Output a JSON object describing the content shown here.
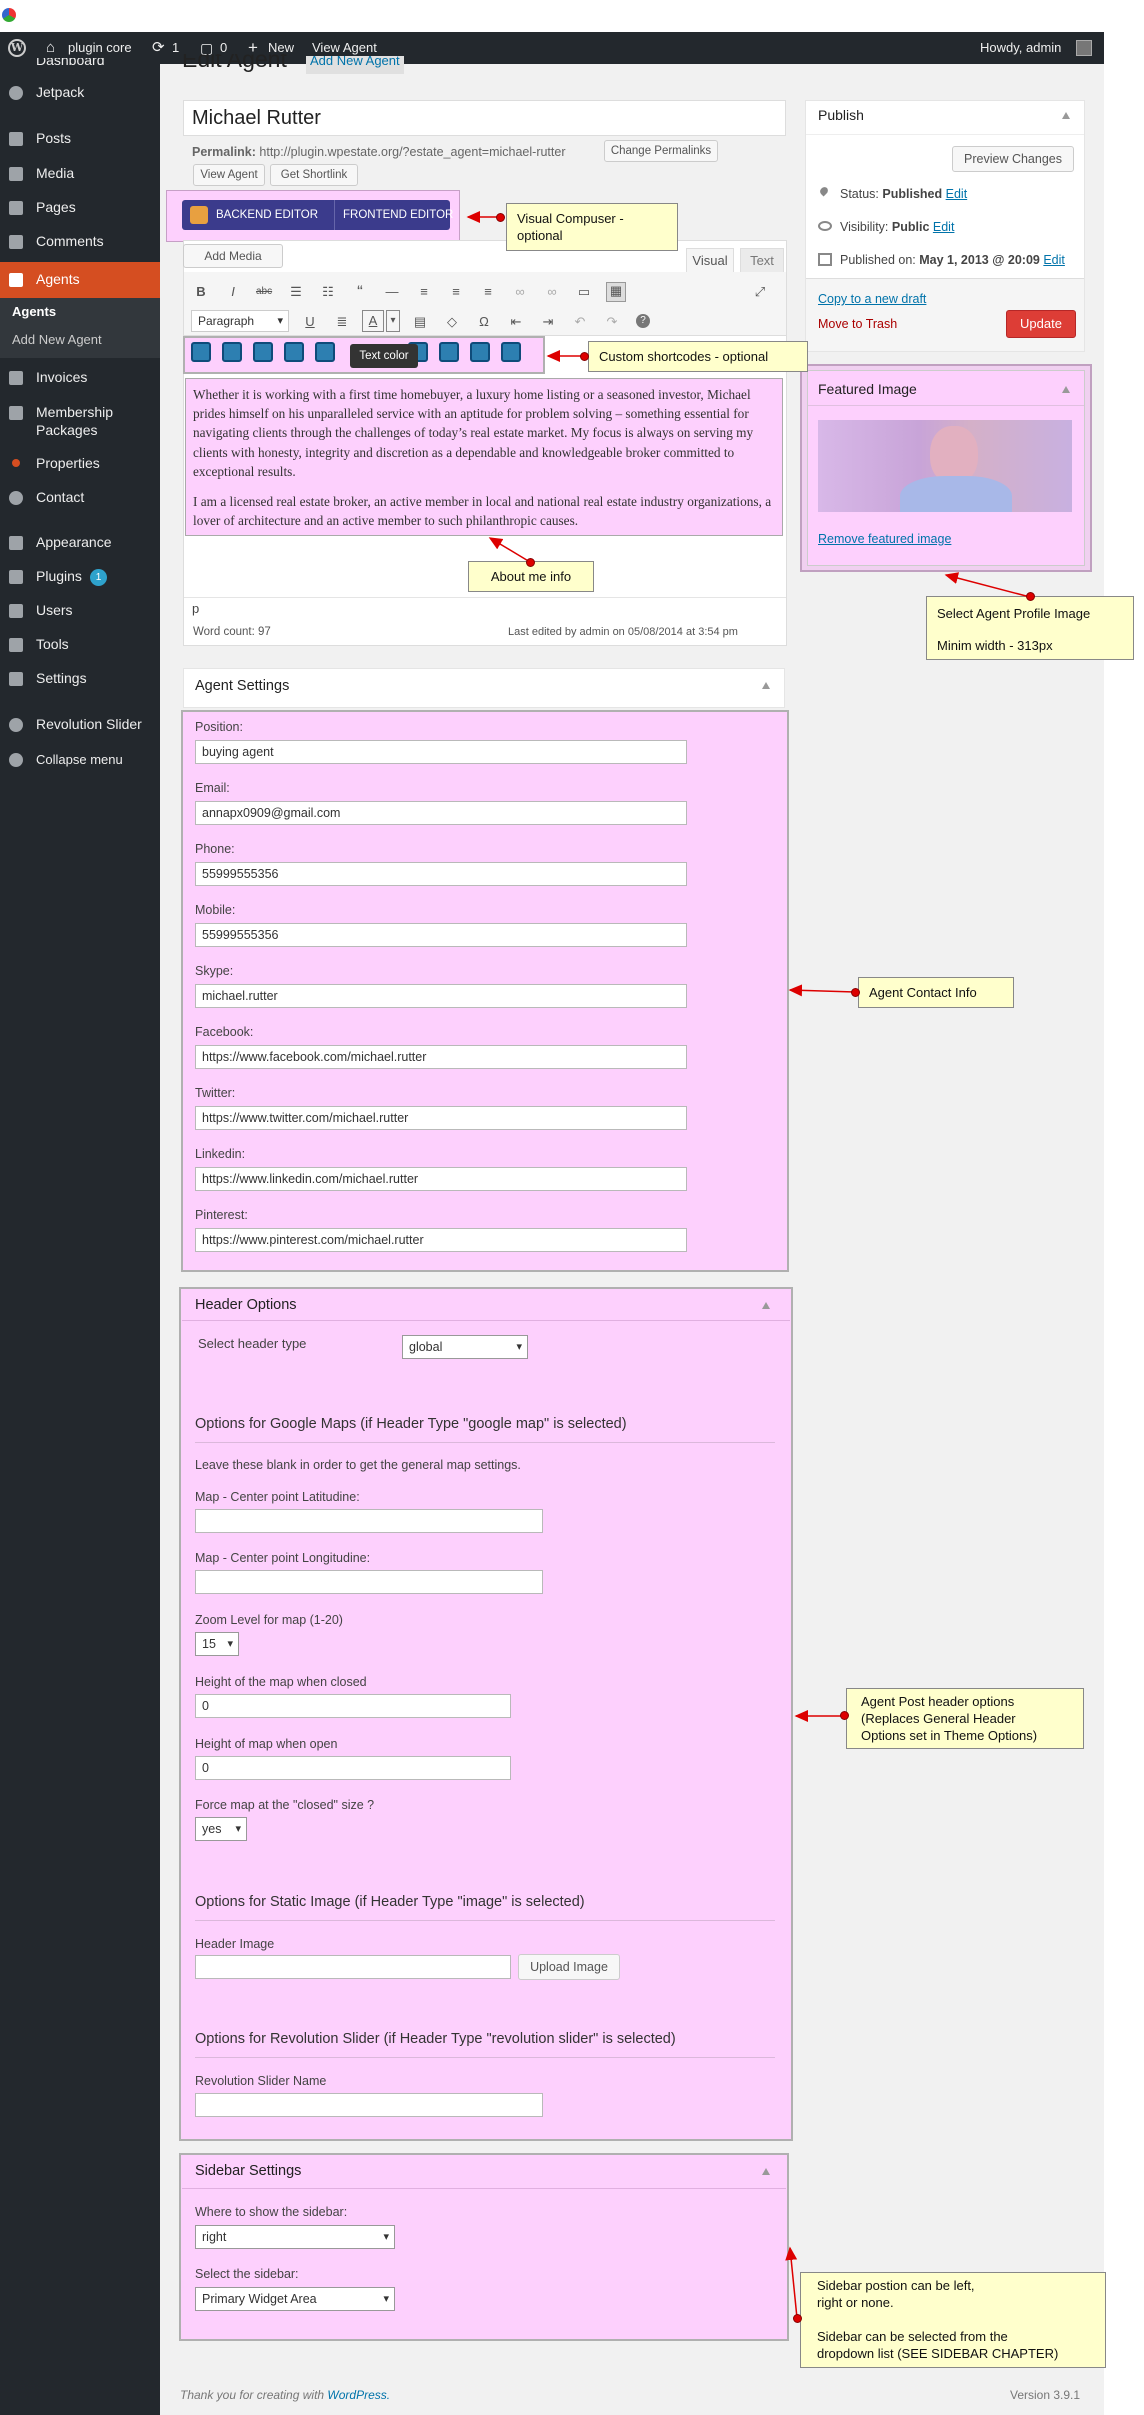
{
  "admin_bar": {
    "site_name": "plugin core",
    "updates": "1",
    "comments": "0",
    "new_label": "New",
    "view_label": "View Agent",
    "howdy": "Howdy, admin"
  },
  "menu": {
    "dashboard": "Dashboard",
    "jetpack": "Jetpack",
    "posts": "Posts",
    "media": "Media",
    "pages": "Pages",
    "comments": "Comments",
    "agents": "Agents",
    "sub_agents": "Agents",
    "sub_add": "Add New Agent",
    "invoices": "Invoices",
    "membership": "Membership",
    "membership2": "Packages",
    "properties": "Properties",
    "contact": "Contact",
    "appearance": "Appearance",
    "plugins": "Plugins",
    "plugins_badge": "1",
    "users": "Users",
    "tools": "Tools",
    "settings": "Settings",
    "revslider": "Revolution Slider",
    "collapse": "Collapse menu"
  },
  "page": {
    "title": "Edit Agent",
    "add_new": "Add New Agent"
  },
  "post": {
    "title": "Michael Rutter",
    "permalink_label": "Permalink:",
    "permalink": "http://plugin.wpestate.org/?estate_agent=michael-rutter",
    "change_permalinks": "Change Permalinks",
    "view_agent": "View Agent",
    "get_shortlink": "Get Shortlink"
  },
  "vc": {
    "backend": "BACKEND EDITOR",
    "frontend": "FRONTEND EDITOR"
  },
  "editor": {
    "add_media": "Add Media",
    "tab_visual": "Visual",
    "tab_text": "Text",
    "paragraph": "Paragraph",
    "tooltip": "Text color",
    "p1": "Whether it is working with a first time homebuyer, a luxury home listing or a seasoned investor, Michael prides himself on his unparalleled service with an aptitude for problem solving – something essential for navigating clients through the challenges of today’s real estate market. My focus is always on serving my clients with honesty, integrity and discretion as a dependable and knowledgeable broker committed to exceptional results.",
    "p2": "I am a licensed real estate broker, an active member in local and national real estate industry organizations, a lover of architecture and an active member to such philanthropic causes.",
    "path": "p",
    "word_count": "Word count: 97",
    "last_edited": "Last edited by admin on 05/08/2014 at 3:54 pm"
  },
  "publish": {
    "title": "Publish",
    "preview": "Preview Changes",
    "status_label": "Status:",
    "status": "Published",
    "visibility_label": "Visibility:",
    "visibility": "Public",
    "published_label": "Published on:",
    "published": "May 1, 2013 @ 20:09",
    "edit": "Edit",
    "copy": "Copy to a new draft",
    "trash": "Move to Trash",
    "update": "Update"
  },
  "featured": {
    "title": "Featured Image",
    "remove": "Remove featured image"
  },
  "agent_settings": {
    "title": "Agent Settings",
    "fields": [
      {
        "label": "Position:",
        "value": "buying agent"
      },
      {
        "label": "Email:",
        "value": "annapx0909@gmail.com"
      },
      {
        "label": "Phone:",
        "value": "55999555356"
      },
      {
        "label": "Mobile:",
        "value": "55999555356"
      },
      {
        "label": "Skype:",
        "value": "michael.rutter"
      },
      {
        "label": "Facebook:",
        "value": "https://www.facebook.com/michael.rutter"
      },
      {
        "label": "Twitter:",
        "value": "https://www.twitter.com/michael.rutter"
      },
      {
        "label": "Linkedin:",
        "value": "https://www.linkedin.com/michael.rutter"
      },
      {
        "label": "Pinterest:",
        "value": "https://www.pinterest.com/michael.rutter"
      }
    ]
  },
  "header_options": {
    "title": "Header Options",
    "select_type_label": "Select header type",
    "select_type": "global",
    "gmaps_title": "Options for Google Maps (if Header Type \"google map\" is selected)",
    "gmaps_note": "Leave these blank in order to get the general map settings.",
    "lat_label": "Map - Center point Latitudine:",
    "lng_label": "Map - Center point Longitudine:",
    "zoom_label": "Zoom Level for map (1-20)",
    "zoom": "15",
    "h_closed_label": "Height of the map when closed",
    "h_closed": "0",
    "h_open_label": "Height of map when open",
    "h_open": "0",
    "force_label": "Force map at the \"closed\" size ?",
    "force": "yes",
    "static_title": "Options for Static Image (if Header Type \"image\" is selected)",
    "header_image_label": "Header Image",
    "upload": "Upload Image",
    "rev_title": "Options for Revolution Slider (if Header Type \"revolution slider\" is selected)",
    "rev_label": "Revolution Slider Name"
  },
  "sidebar_settings": {
    "title": "Sidebar Settings",
    "where_label": "Where to show the sidebar:",
    "where": "right",
    "select_label": "Select the sidebar:",
    "select": "Primary Widget Area"
  },
  "notes": {
    "vc": "Visual Compuser - optional",
    "shortcodes": "Custom shortcodes - optional",
    "about": "About me info",
    "profile1": "Select Agent Profile Image",
    "profile2": "Minim width - 313px",
    "contact": "Agent Contact Info",
    "header1": "Agent Post header options",
    "header2": "(Replaces General Header",
    "header3": "Options set in Theme Options)",
    "side1": "Sidebar postion can be left,",
    "side2": "right or none.",
    "side3": "Sidebar can be selected from the",
    "side4": "dropdown list (SEE SIDEBAR CHAPTER)"
  },
  "footer": {
    "thanks": "Thank you for creating with",
    "wp": "WordPress.",
    "version": "Version 3.9.1"
  }
}
